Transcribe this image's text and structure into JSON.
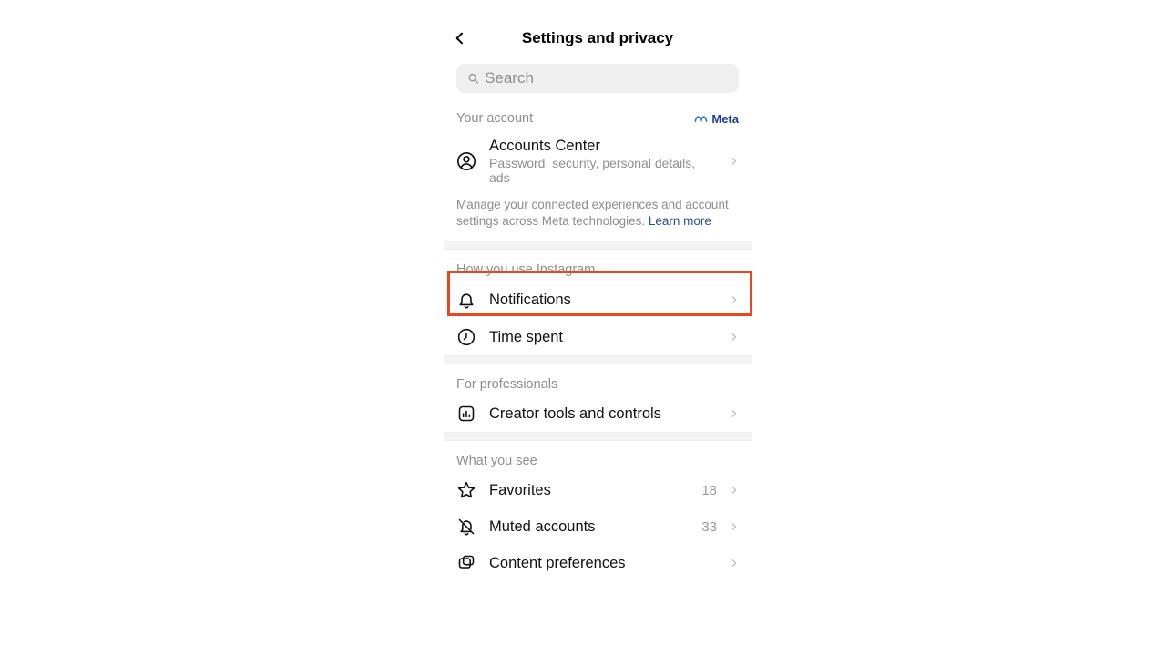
{
  "header": {
    "title": "Settings and privacy"
  },
  "search": {
    "placeholder": "Search"
  },
  "sections": {
    "account": {
      "heading": "Your account",
      "meta_label": "Meta",
      "accounts_center": {
        "title": "Accounts Center",
        "subtitle": "Password, security, personal details, ads"
      },
      "note": "Manage your connected experiences and account settings across Meta technologies.",
      "learn_more": "Learn more"
    },
    "usage": {
      "heading": "How you use Instagram",
      "notifications": "Notifications",
      "time_spent": "Time spent"
    },
    "professionals": {
      "heading": "For professionals",
      "creator_tools": "Creator tools and controls"
    },
    "what_you_see": {
      "heading": "What you see",
      "favorites": {
        "label": "Favorites",
        "count": "18"
      },
      "muted": {
        "label": "Muted accounts",
        "count": "33"
      },
      "content": {
        "label": "Content preferences"
      }
    }
  }
}
